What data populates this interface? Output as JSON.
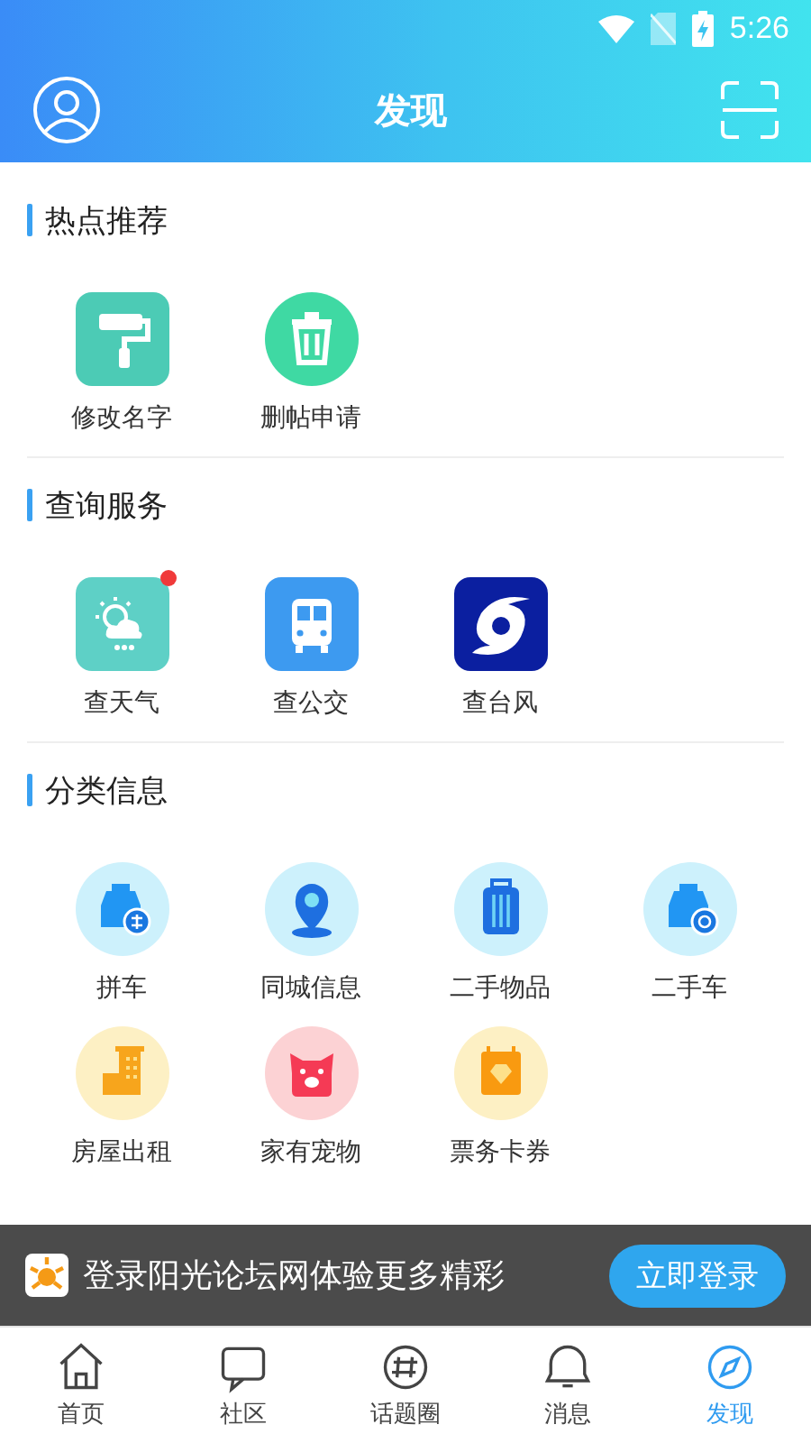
{
  "status_bar": {
    "time": "5:26"
  },
  "header": {
    "title": "发现"
  },
  "sections": [
    {
      "title": "热点推荐",
      "items": [
        {
          "label": "修改名字",
          "badge": false
        },
        {
          "label": "删帖申请",
          "badge": false
        }
      ]
    },
    {
      "title": "查询服务",
      "items": [
        {
          "label": "查天气",
          "badge": true
        },
        {
          "label": "查公交",
          "badge": false
        },
        {
          "label": "查台风",
          "badge": false
        }
      ]
    },
    {
      "title": "分类信息",
      "items": [
        {
          "label": "拼车",
          "badge": false
        },
        {
          "label": "同城信息",
          "badge": false
        },
        {
          "label": "二手物品",
          "badge": false
        },
        {
          "label": "二手车",
          "badge": false
        },
        {
          "label": "房屋出租",
          "badge": false
        },
        {
          "label": "家有宠物",
          "badge": false
        },
        {
          "label": "票务卡券",
          "badge": false
        }
      ]
    }
  ],
  "login_banner": {
    "text": "登录阳光论坛网体验更多精彩",
    "button": "立即登录"
  },
  "tab_bar": [
    {
      "label": "首页",
      "selected": false
    },
    {
      "label": "社区",
      "selected": false
    },
    {
      "label": "话题圈",
      "selected": false
    },
    {
      "label": "消息",
      "selected": false
    },
    {
      "label": "发现",
      "selected": true
    }
  ]
}
